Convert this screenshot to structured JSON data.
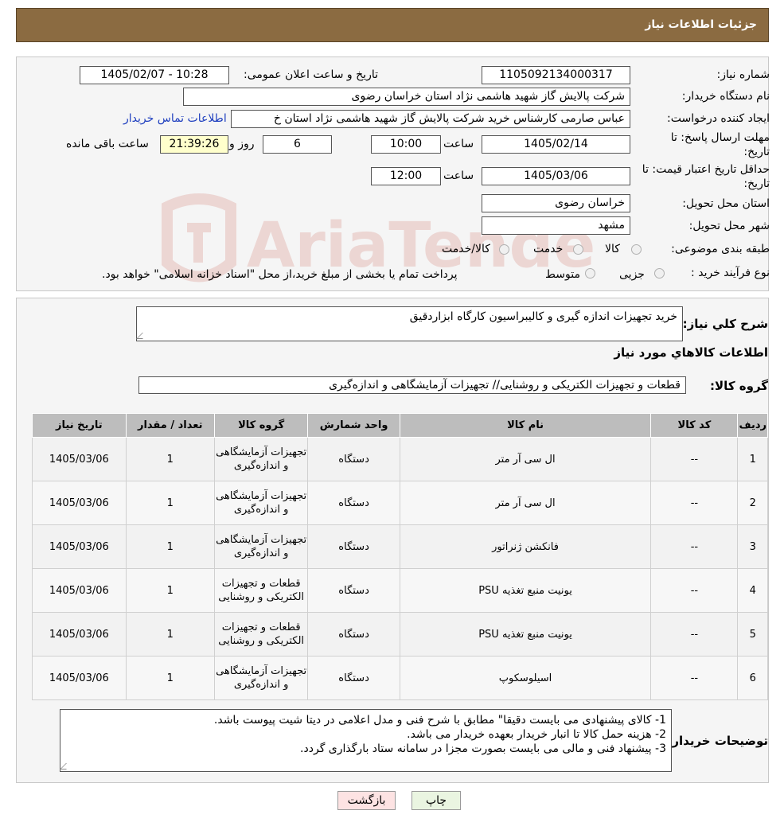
{
  "header": {
    "title": "جزئیات اطلاعات نیاز"
  },
  "form": {
    "need_number_label": "شماره نیاز:",
    "need_number": "1105092134000317",
    "announce_label": "تاریخ و ساعت اعلان عمومی:",
    "announce_value": "1405/02/07 - 10:28",
    "buyer_org_label": "نام دستگاه خریدار:",
    "buyer_org": "شرکت پالایش گاز شهید هاشمی نژاد   استان خراسان رضوی",
    "requester_label": "ایجاد کننده درخواست:",
    "requester": "عباس صارمی کارشناس خرید  شرکت پالایش گاز شهید هاشمی نژاد   استان خ",
    "contact_link": "اطلاعات تماس خریدار",
    "reply_deadline_label": "مهلت ارسال پاسخ: تا",
    "reply_deadline_label2": "تاریخ:",
    "reply_date": "1405/02/14",
    "time_label": "ساعت",
    "reply_time": "10:00",
    "days_value": "6",
    "days_label": "روز و",
    "remaining_time": "21:39:26",
    "remaining_label": "ساعت باقی مانده",
    "price_validity_label": "حداقل تاریخ اعتبار قیمت: تا",
    "price_validity_label2": "تاریخ:",
    "validity_date": "1405/03/06",
    "validity_time_label": "ساعت",
    "validity_time": "12:00",
    "province_label": "استان محل تحویل:",
    "province": "خراسان رضوی",
    "city_label": "شهر محل تحویل:",
    "city": "مشهد",
    "category_label": "طبقه بندی موضوعی:",
    "category_options": [
      "کالا",
      "خدمت",
      "کالا/خدمت"
    ],
    "process_label": "نوع فرآیند خرید :",
    "process_options": [
      "جزیی",
      "متوسط"
    ],
    "process_note": "پرداخت تمام یا بخشی از مبلغ خرید،از محل \"اسناد خزانه اسلامی\" خواهد بود."
  },
  "summary": {
    "label": "شرح کلي نياز:",
    "text": "خرید تجهیزات اندازه گیری و کالیبراسیون کارگاه ابزاردقیق"
  },
  "goods": {
    "section_title": "اطلاعات کالاهاي مورد نياز",
    "group_label": "گروه کالا:",
    "group_value": "قطعات و تجهیزات الکتریکی و روشنایی// تجهیزات آزمایشگاهی و اندازه‌گیری",
    "columns": [
      "رديف",
      "کد کالا",
      "نام کالا",
      "واحد شمارش",
      "گروه کالا",
      "تعداد / مقدار",
      "تاريخ نياز"
    ],
    "rows": [
      [
        "1",
        "--",
        "ال سی آر متر",
        "دستگاه",
        "تجهیزات آزمایشگاهی و اندازه‌گیری",
        "1",
        "1405/03/06"
      ],
      [
        "2",
        "--",
        "ال سی آر متر",
        "دستگاه",
        "تجهیزات آزمایشگاهی و اندازه‌گیری",
        "1",
        "1405/03/06"
      ],
      [
        "3",
        "--",
        "فانکشن ژنراتور",
        "دستگاه",
        "تجهیزات آزمایشگاهی و اندازه‌گیری",
        "1",
        "1405/03/06"
      ],
      [
        "4",
        "--",
        "یونیت منبع تغذیه PSU",
        "دستگاه",
        "قطعات و تجهیزات الکتریکی و روشنایی",
        "1",
        "1405/03/06"
      ],
      [
        "5",
        "--",
        "یونیت منبع تغذیه PSU",
        "دستگاه",
        "قطعات و تجهیزات الکتریکی و روشنایی",
        "1",
        "1405/03/06"
      ],
      [
        "6",
        "--",
        "اسیلوسکوپ",
        "دستگاه",
        "تجهیزات آزمایشگاهی و اندازه‌گیری",
        "1",
        "1405/03/06"
      ]
    ]
  },
  "notes": {
    "label": "توضیحات خریدار:",
    "lines": [
      "1-     کالای پیشنهادی می بایست دقیقا\" مطابق با شرح فنی و مدل اعلامی در دیتا شیت پیوست باشد.",
      "2-     هزینه حمل کالا تا انبار خریدار بعهده خریدار می باشد.",
      "3-     پیشنهاد فنی و مالی می بایست بصورت مجزا در سامانه ستاد بارگذاری گردد."
    ]
  },
  "buttons": {
    "print": "چاپ",
    "back": "بازگشت"
  },
  "watermark_text": "AriaTender.neT",
  "colors": {
    "header_bg": "#8b6b41",
    "back_btn_bg": "#fde3e3",
    "print_btn_bg": "#eaf5e1",
    "watermark": "#c0392b"
  }
}
